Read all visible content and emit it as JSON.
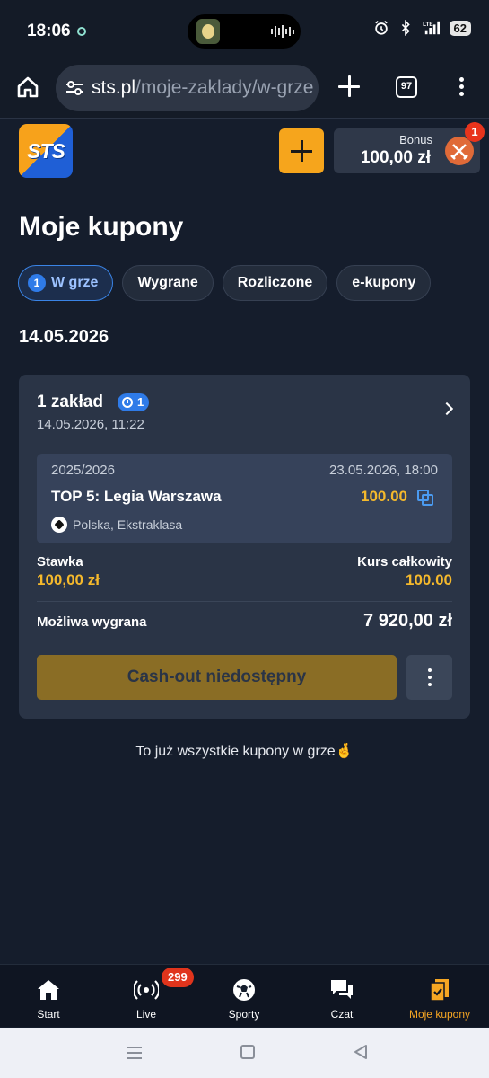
{
  "status_bar": {
    "time": "18:06",
    "battery": "62",
    "network": "LTE"
  },
  "browser": {
    "url_domain": "sts.pl",
    "url_path": "/moje-zaklady/w-grze",
    "tab_count": "97"
  },
  "header": {
    "logo_text": "STS",
    "bonus_label": "Bonus",
    "bonus_amount": "100,00 zł",
    "bonus_badge": "1"
  },
  "page": {
    "title": "Moje kupony",
    "filters": [
      {
        "label": "W grze",
        "count": "1",
        "active": true
      },
      {
        "label": "Wygrane",
        "active": false
      },
      {
        "label": "Rozliczone",
        "active": false
      },
      {
        "label": "e-kupony",
        "active": false
      }
    ],
    "date_heading": "14.05.2026"
  },
  "coupon": {
    "title": "1 zakład",
    "live_count": "1",
    "placed_at": "14.05.2026, 11:22",
    "event": {
      "season": "2025/2026",
      "date": "23.05.2026, 18:00",
      "name": "TOP 5: Legia Warszawa",
      "odds": "100.00",
      "league": "Polska, Ekstraklasa"
    },
    "stake_label": "Stawka",
    "stake_value": "100,00 zł",
    "total_odds_label": "Kurs całkowity",
    "total_odds_value": "100.00",
    "possible_win_label": "Możliwa wygrana",
    "possible_win_value": "7 920,00 zł",
    "cashout_label": "Cash-out niedostępny"
  },
  "end_note": "To już wszystkie kupony w grze🤞",
  "bottom_nav": {
    "items": [
      {
        "label": "Start",
        "icon": "home-icon"
      },
      {
        "label": "Live",
        "icon": "live-icon",
        "badge": "299"
      },
      {
        "label": "Sporty",
        "icon": "sports-icon"
      },
      {
        "label": "Czat",
        "icon": "chat-icon"
      },
      {
        "label": "Moje kupony",
        "icon": "coupons-icon",
        "active": true
      }
    ]
  },
  "colors": {
    "background": "#151d2c",
    "accent": "#f5b92c",
    "active_blue": "#2f7be8",
    "card": "#2a3446"
  }
}
